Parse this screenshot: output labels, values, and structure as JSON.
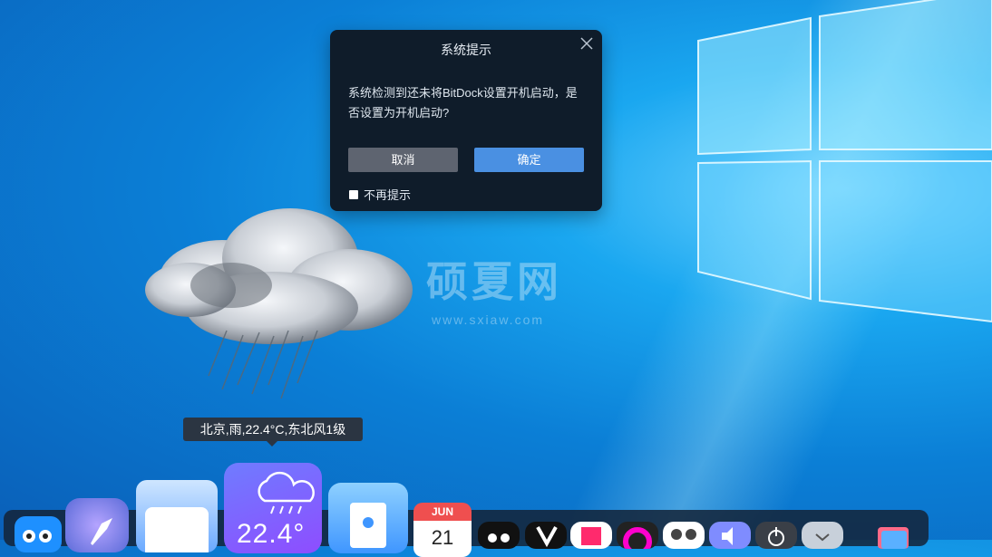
{
  "dialog": {
    "title": "系统提示",
    "message": "系统检测到还未将BitDock设置开机启动，是否设置为开机启动?",
    "cancel_label": "取消",
    "ok_label": "确定",
    "checkbox_label": "不再提示",
    "close_icon": "close-icon"
  },
  "watermark": {
    "title": "硕夏网",
    "url": "www.sxiaw.com"
  },
  "weather": {
    "tooltip": "北京,雨,22.4°C,东北风1级",
    "tile_temp": "22.4°"
  },
  "dock": {
    "calendar_month": "JUN",
    "calendar_day": "21"
  },
  "colors": {
    "dialog_bg": "#0f1c2a",
    "cancel_bg": "#5e6470",
    "ok_bg": "#4a90e2",
    "dock_bg": "#14233a"
  }
}
